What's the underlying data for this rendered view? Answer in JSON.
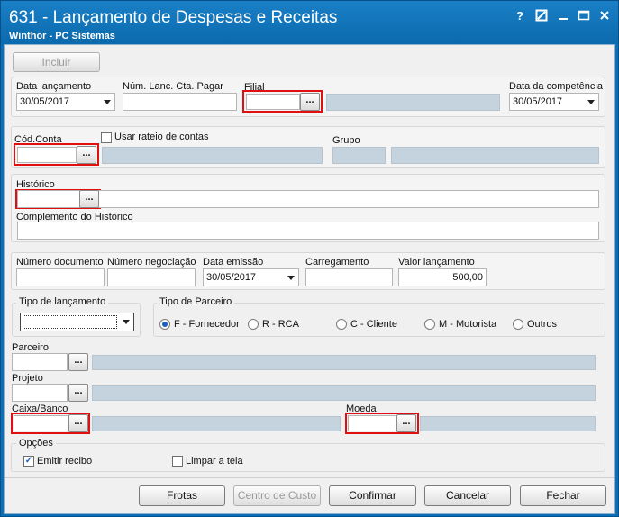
{
  "window": {
    "title": "631 - Lançamento de Despesas e Receitas",
    "subtitle": "Winthor - PC Sistemas",
    "help_icon": "?",
    "controls": [
      "help-icon",
      "pin-icon",
      "minimize-icon",
      "maximize-icon",
      "close-icon"
    ]
  },
  "toolbar": {
    "incluir_label": "Incluir"
  },
  "row1": {
    "data_lancamento_label": "Data lançamento",
    "data_lancamento_value": "30/05/2017",
    "num_lanc_label": "Núm. Lanc. Cta. Pagar",
    "filial_label": "Filial",
    "data_competencia_label": "Data da competência",
    "data_competencia_value": "30/05/2017"
  },
  "row2": {
    "cod_conta_label": "Cód.Conta",
    "usar_rateio_label": "Usar rateio de contas",
    "usar_rateio_checked": false,
    "grupo_label": "Grupo"
  },
  "row3": {
    "historico_label": "Histórico",
    "complemento_label": "Complemento do Histórico"
  },
  "row4": {
    "numero_documento_label": "Número documento",
    "numero_negociacao_label": "Número negociação",
    "data_emissao_label": "Data emissão",
    "data_emissao_value": "30/05/2017",
    "carregamento_label": "Carregamento",
    "valor_lancamento_label": "Valor lançamento",
    "valor_lancamento_value": "500,00"
  },
  "tipo_lancamento": {
    "label": "Tipo de lançamento",
    "value": ""
  },
  "tipo_parceiro": {
    "label": "Tipo de Parceiro",
    "options": [
      {
        "label": "F - Fornecedor",
        "selected": true
      },
      {
        "label": "R - RCA",
        "selected": false
      },
      {
        "label": "C - Cliente",
        "selected": false
      },
      {
        "label": "M - Motorista",
        "selected": false
      },
      {
        "label": "Outros",
        "selected": false
      }
    ]
  },
  "parceiro_label": "Parceiro",
  "projeto_label": "Projeto",
  "caixa_banco_label": "Caixa/Banco",
  "moeda_label": "Moeda",
  "ellipsis": "...",
  "opcoes": {
    "label": "Opções",
    "emitir_recibo_label": "Emitir recibo",
    "emitir_recibo_checked": true,
    "limpar_tela_label": "Limpar a tela",
    "limpar_tela_checked": false
  },
  "footer": {
    "frotas": "Frotas",
    "centro_custo": "Centro de Custo",
    "confirmar": "Confirmar",
    "cancelar": "Cancelar",
    "fechar": "Fechar"
  },
  "colors": {
    "titlebar": "#0b6aad",
    "highlight": "#e01010",
    "readonly": "#c5d3df"
  }
}
